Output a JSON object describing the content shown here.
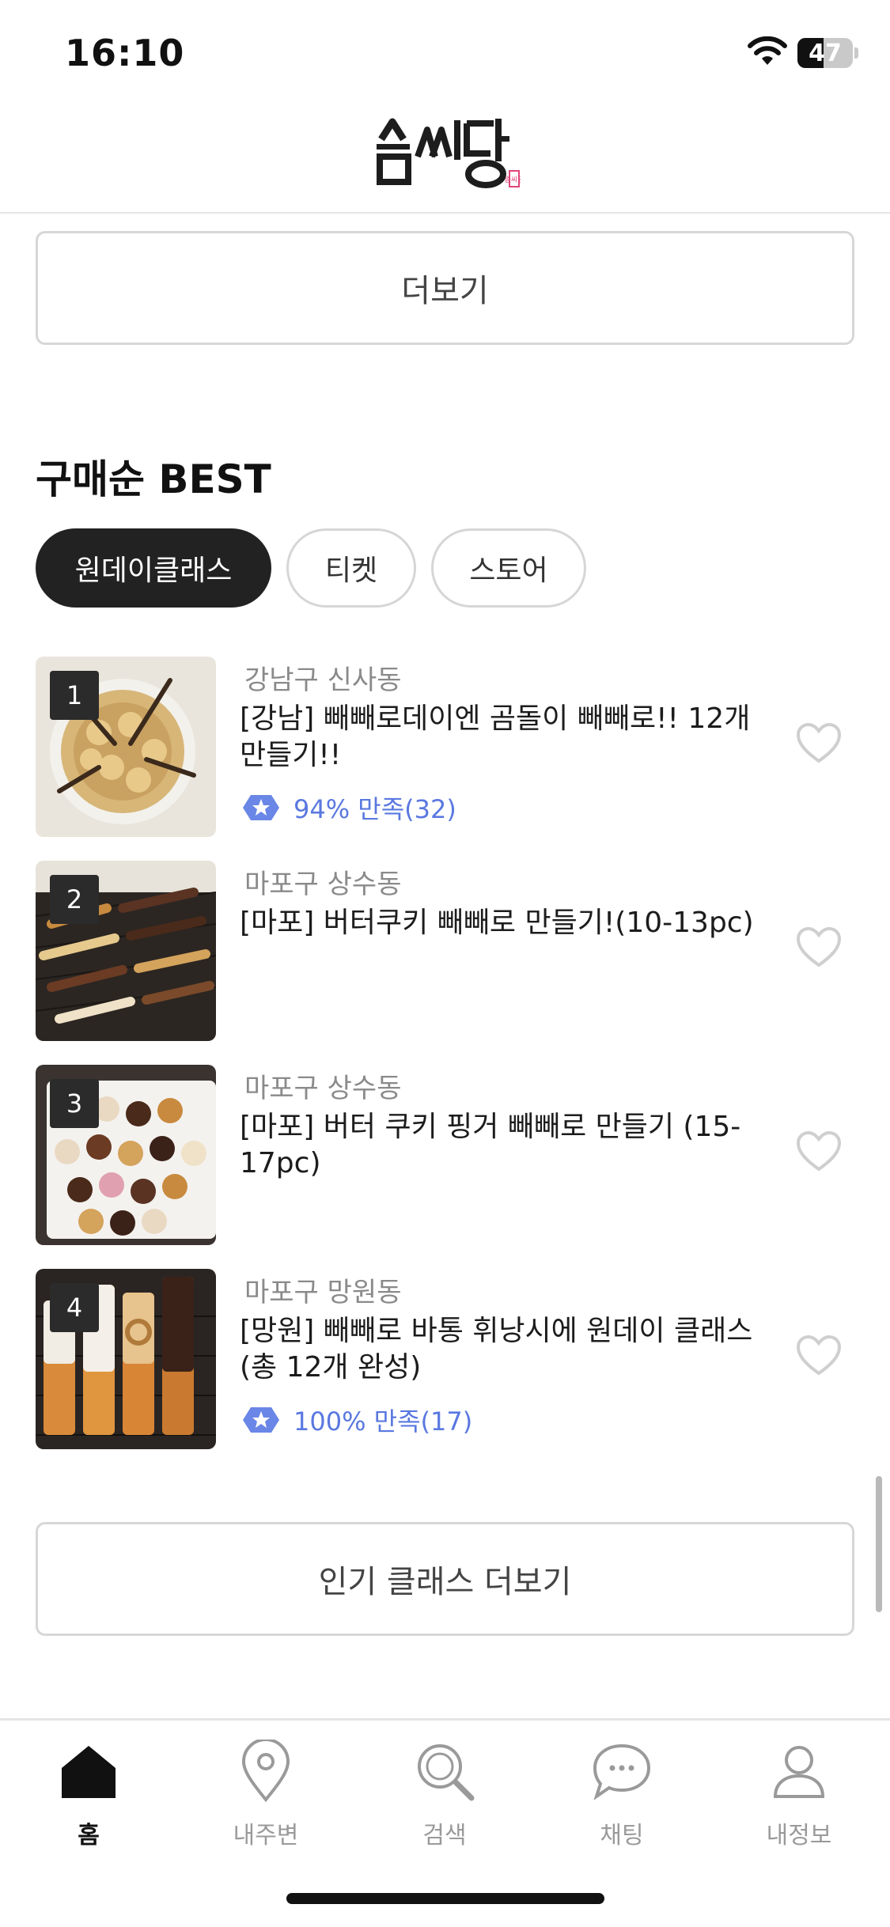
{
  "status_bar": {
    "time": "16:10",
    "battery": "47",
    "battery_level": 0.47
  },
  "header": {
    "logo_text": "솜씨당"
  },
  "top_more_button": "더보기",
  "section": {
    "title": "구매순 BEST",
    "chips": [
      {
        "label": "원데이클래스",
        "active": true
      },
      {
        "label": "티켓",
        "active": false
      },
      {
        "label": "스토어",
        "active": false
      }
    ]
  },
  "items": [
    {
      "rank": "1",
      "location": "강남구 신사동",
      "title": "[강남] 빼빼로데이엔 곰돌이 빼빼로!! 12개 만들기!!",
      "rating": "94% 만족(32)"
    },
    {
      "rank": "2",
      "location": "마포구 상수동",
      "title": "[마포] 버터쿠키 빼빼로 만들기!(10-13pc)",
      "rating": ""
    },
    {
      "rank": "3",
      "location": "마포구 상수동",
      "title": "[마포] 버터 쿠키 핑거 빼빼로 만들기 (15-17pc)",
      "rating": ""
    },
    {
      "rank": "4",
      "location": "마포구 망원동",
      "title": "[망원] 빼빼로 바통 휘낭시에 원데이 클래스(총 12개 완성)",
      "rating": "100% 만족(17)"
    }
  ],
  "bottom_more_button": "인기 클래스 더보기",
  "tabbar": {
    "tabs": [
      {
        "label": "홈",
        "icon": "home-icon",
        "active": true
      },
      {
        "label": "내주변",
        "icon": "location-pin-icon",
        "active": false
      },
      {
        "label": "검색",
        "icon": "search-icon",
        "active": false
      },
      {
        "label": "채팅",
        "icon": "chat-bubble-icon",
        "active": false
      },
      {
        "label": "내정보",
        "icon": "profile-icon",
        "active": false
      }
    ]
  },
  "colors": {
    "accent_rating": "#5a78e0",
    "chip_active_bg": "#222222"
  }
}
